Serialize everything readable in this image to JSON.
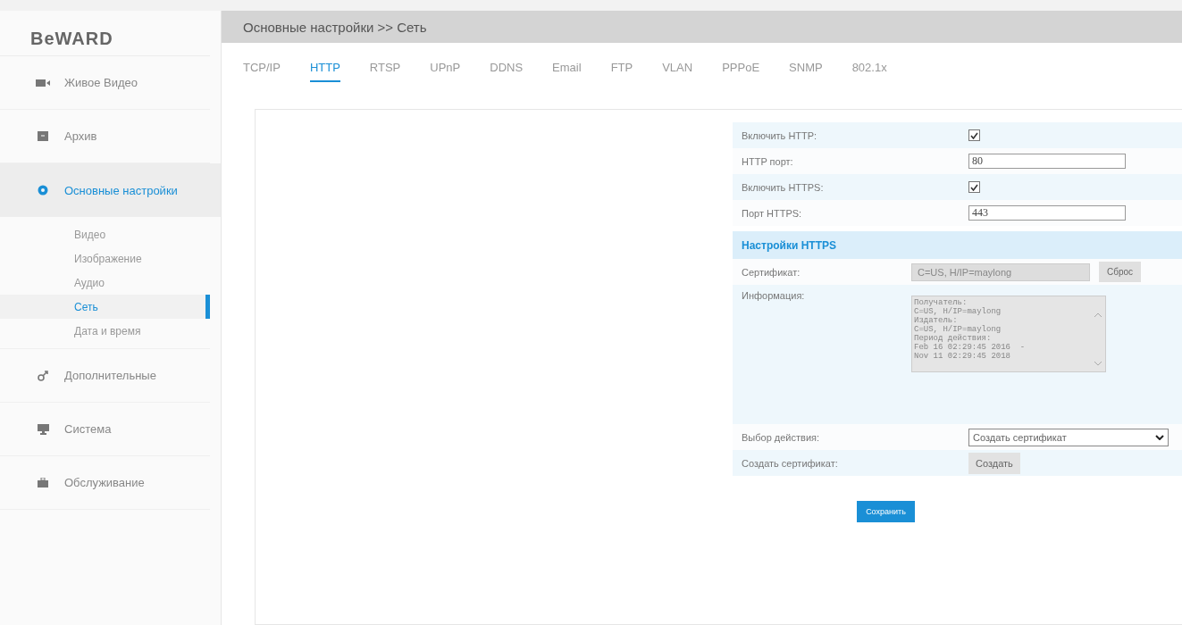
{
  "logo": "BeWARD",
  "sidebar": {
    "items": [
      {
        "label": "Живое Видео",
        "selected": false
      },
      {
        "label": "Архив",
        "selected": false
      },
      {
        "label": "Основные настройки",
        "selected": true,
        "children": [
          {
            "label": "Видео",
            "selected": false
          },
          {
            "label": "Изображение",
            "selected": false
          },
          {
            "label": "Аудио",
            "selected": false
          },
          {
            "label": "Сеть",
            "selected": true
          },
          {
            "label": "Дата и время",
            "selected": false
          }
        ]
      },
      {
        "label": "Дополнительные",
        "selected": false
      },
      {
        "label": "Система",
        "selected": false
      },
      {
        "label": "Обслуживание",
        "selected": false
      }
    ]
  },
  "breadcrumb": "Основные настройки >> Сеть",
  "tabs": [
    {
      "label": "TCP/IP",
      "selected": false
    },
    {
      "label": "HTTP",
      "selected": true
    },
    {
      "label": "RTSP",
      "selected": false
    },
    {
      "label": "UPnP",
      "selected": false
    },
    {
      "label": "DDNS",
      "selected": false
    },
    {
      "label": "Email",
      "selected": false
    },
    {
      "label": "FTP",
      "selected": false
    },
    {
      "label": "VLAN",
      "selected": false
    },
    {
      "label": "PPPoE",
      "selected": false
    },
    {
      "label": "SNMP",
      "selected": false
    },
    {
      "label": "802.1x",
      "selected": false
    }
  ],
  "form": {
    "rows": [
      {
        "kind": "checkbox",
        "label": "Включить HTTP:",
        "checked": true
      },
      {
        "kind": "text",
        "label": "HTTP порт:",
        "value": "80"
      },
      {
        "kind": "checkbox",
        "label": "Включить HTTPS:",
        "checked": true
      },
      {
        "kind": "text",
        "label": "Порт HTTPS:",
        "value": "443"
      },
      {
        "kind": "section",
        "label": "Настройки HTTPS"
      },
      {
        "kind": "readonly",
        "label": "Сертификат:",
        "value": "C=US, H/IP=maylong",
        "button": "Сброс"
      },
      {
        "kind": "textarea",
        "label": "Информация:",
        "value": "Получатель:\nC=US, H/IP=maylong\nИздатель:\nC=US, H/IP=maylong\nПериод действия:\nFeb 16 02:29:45 2016  -\nNov 11 02:29:45 2018"
      },
      {
        "kind": "select",
        "label": "Выбор действия:",
        "value": "Создать сертификат"
      },
      {
        "kind": "button",
        "label": "Создать сертификат:",
        "button": "Создать"
      }
    ],
    "save": "Сохранить"
  }
}
